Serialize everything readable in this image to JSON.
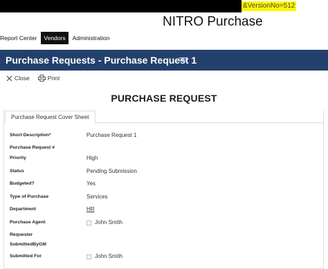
{
  "browser": {
    "url_fragment": "&VersionNo=512"
  },
  "app": {
    "title": "NITRO Purchase"
  },
  "topnav": [
    {
      "label": "Report Center",
      "active": false
    },
    {
      "label": "Vendors",
      "active": true
    },
    {
      "label": "Administration",
      "active": false
    }
  ],
  "header": {
    "title": "Purchase Requests - Purchase Request 1",
    "link_icon": "link-icon"
  },
  "toolbar": {
    "close_label": "Close",
    "print_label": "Print"
  },
  "document": {
    "title": "PURCHASE REQUEST"
  },
  "tabs": [
    {
      "label": "Purchase Request Cover Sheet"
    }
  ],
  "form": {
    "short_description": {
      "label": "Short Description",
      "required_mark": "*",
      "value": "Purchase Request 1"
    },
    "pr_number": {
      "label": "Purchase Request #",
      "value": ""
    },
    "priority": {
      "label": "Priority",
      "value": "High"
    },
    "status": {
      "label": "Status",
      "value": "Pending Submission"
    },
    "budgeted": {
      "label": "Budgeted?",
      "value": "Yes"
    },
    "type_of_purchase": {
      "label": "Type of Purchase",
      "value": "Services"
    },
    "department": {
      "label": "Department",
      "value": "HR"
    },
    "purchase_agent": {
      "label": "Purchase Agent",
      "value": "John Smith"
    },
    "requester": {
      "label": "Requester",
      "value": ""
    },
    "submitted_by_gm": {
      "label": "SubmittedByGM",
      "value": ""
    },
    "submitted_for": {
      "label": "Submitted For",
      "value": "John Smith"
    }
  }
}
